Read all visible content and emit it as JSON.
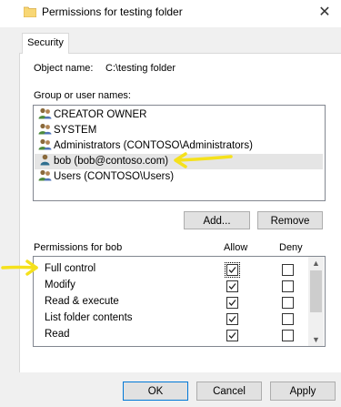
{
  "window": {
    "title": "Permissions for testing folder",
    "close_glyph": "✕"
  },
  "tabs": [
    {
      "label": "Security"
    }
  ],
  "object": {
    "label": "Object name:",
    "value": "C:\\testing folder"
  },
  "groups": {
    "label": "Group or user names:",
    "items": [
      {
        "label": "CREATOR OWNER",
        "icon": "group-users-icon"
      },
      {
        "label": "SYSTEM",
        "icon": "group-users-icon"
      },
      {
        "label": "Administrators (CONTOSO\\Administrators)",
        "icon": "group-users-icon"
      },
      {
        "label": "bob (bob@contoso.com)",
        "icon": "single-user-icon",
        "selected": true
      },
      {
        "label": "Users (CONTOSO\\Users)",
        "icon": "group-users-icon"
      }
    ]
  },
  "buttons": {
    "add": "Add...",
    "remove": "Remove",
    "ok": "OK",
    "cancel": "Cancel",
    "apply": "Apply"
  },
  "permissions": {
    "header": "Permissions for bob",
    "allow_header": "Allow",
    "deny_header": "Deny",
    "rows": [
      {
        "label": "Full control",
        "allow": true,
        "deny": false,
        "focused": true
      },
      {
        "label": "Modify",
        "allow": true,
        "deny": false
      },
      {
        "label": "Read & execute",
        "allow": true,
        "deny": false
      },
      {
        "label": "List folder contents",
        "allow": true,
        "deny": false
      },
      {
        "label": "Read",
        "allow": true,
        "deny": false
      }
    ]
  },
  "colors": {
    "annotation": "#f5e11c",
    "selection": "#e5e5e5",
    "ok_border": "#0078d7"
  }
}
